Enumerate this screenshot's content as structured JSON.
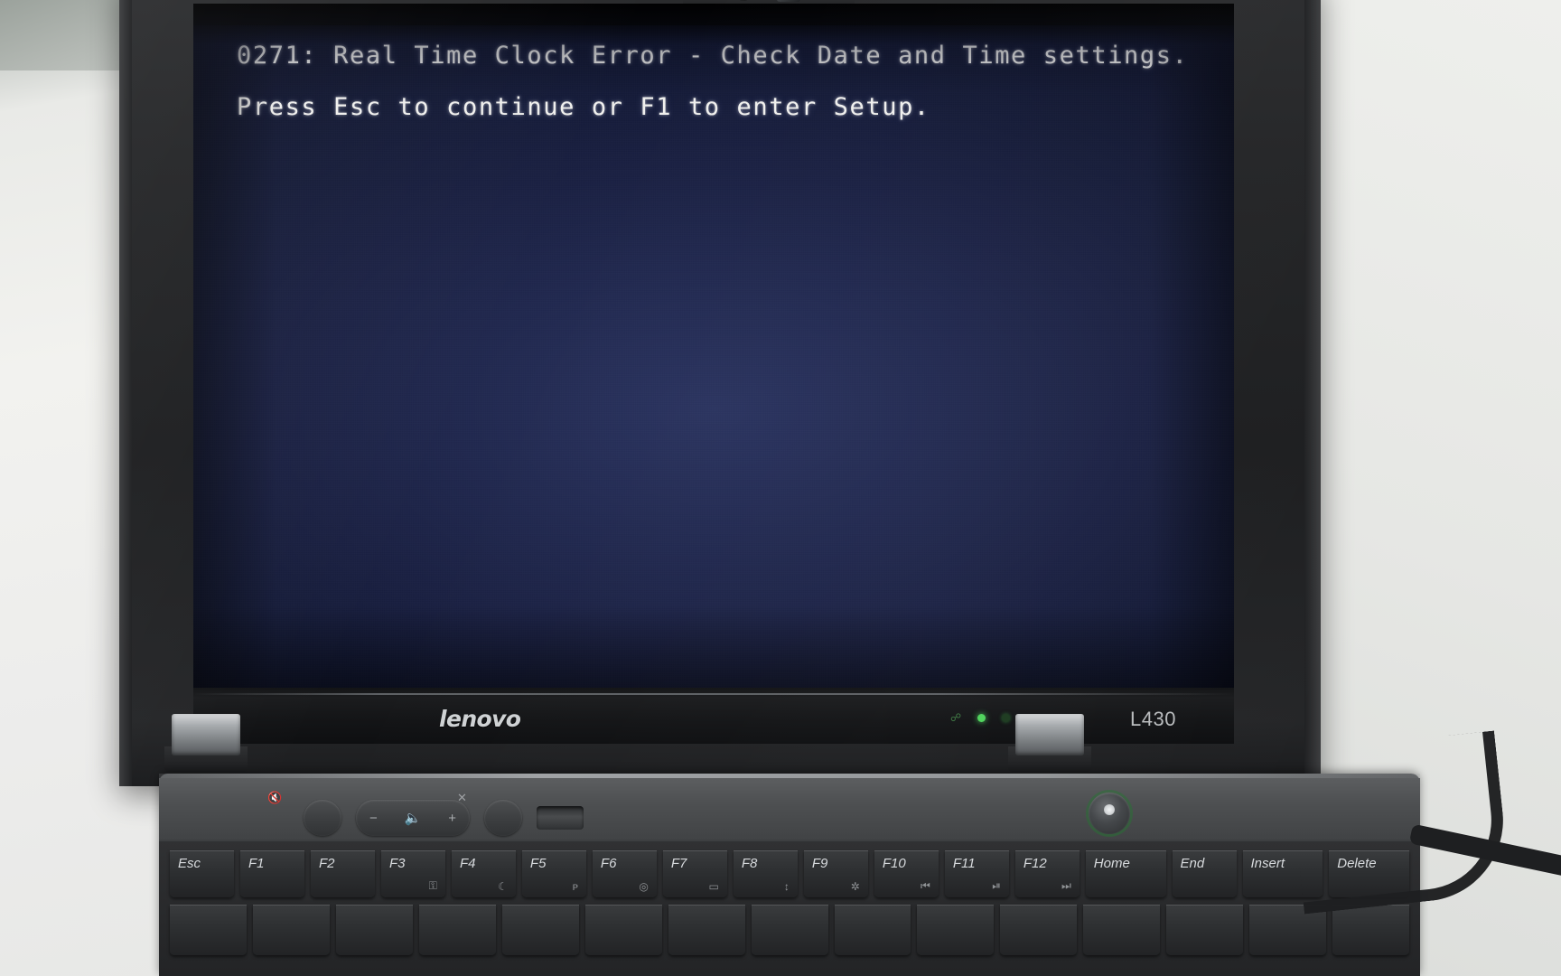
{
  "device": {
    "brand": "lenovo",
    "model": "L430",
    "type": "laptop"
  },
  "screen": {
    "mode": "bios-error",
    "background_color": "#1b2143",
    "text_color": "#f1f1ef",
    "lines": [
      "0271: Real Time Clock Error - Check Date and Time settings.",
      "Press Esc to continue or F1 to enter Setup."
    ],
    "error_code": "0271",
    "error_title": "Real Time Clock Error - Check Date and Time settings.",
    "prompt": "Press Esc to continue or F1 to enter Setup."
  },
  "indicators": {
    "power_led_color": "#4fd35c",
    "status_leds": [
      {
        "name": "bluetooth-led",
        "state": "on"
      },
      {
        "name": "battery-led",
        "state": "off"
      }
    ]
  },
  "media_buttons": [
    {
      "name": "mute-button",
      "label": "",
      "icon": "speaker-mute-icon"
    },
    {
      "name": "volume-down-button",
      "label": "−",
      "icon": "minus-icon"
    },
    {
      "name": "volume-icon",
      "label": "",
      "icon": "speaker-icon"
    },
    {
      "name": "volume-up-button",
      "label": "+",
      "icon": "plus-icon"
    },
    {
      "name": "mic-mute-button",
      "label": "",
      "icon": "microphone-mute-icon"
    }
  ],
  "keyboard": {
    "function_row": [
      {
        "label": "Esc",
        "sub": ""
      },
      {
        "label": "F1",
        "sub": ""
      },
      {
        "label": "F2",
        "sub": ""
      },
      {
        "label": "F3",
        "sub": "⚿"
      },
      {
        "label": "F4",
        "sub": "☾"
      },
      {
        "label": "F5",
        "sub": "ᴘ"
      },
      {
        "label": "F6",
        "sub": "◎"
      },
      {
        "label": "F7",
        "sub": "▭"
      },
      {
        "label": "F8",
        "sub": "↕"
      },
      {
        "label": "F9",
        "sub": "✲"
      },
      {
        "label": "F10",
        "sub": "⏮"
      },
      {
        "label": "F11",
        "sub": "⏯"
      },
      {
        "label": "F12",
        "sub": "⏭"
      },
      {
        "label": "Home",
        "sub": ""
      },
      {
        "label": "End",
        "sub": ""
      },
      {
        "label": "Insert",
        "sub": ""
      },
      {
        "label": "Delete",
        "sub": ""
      }
    ]
  }
}
